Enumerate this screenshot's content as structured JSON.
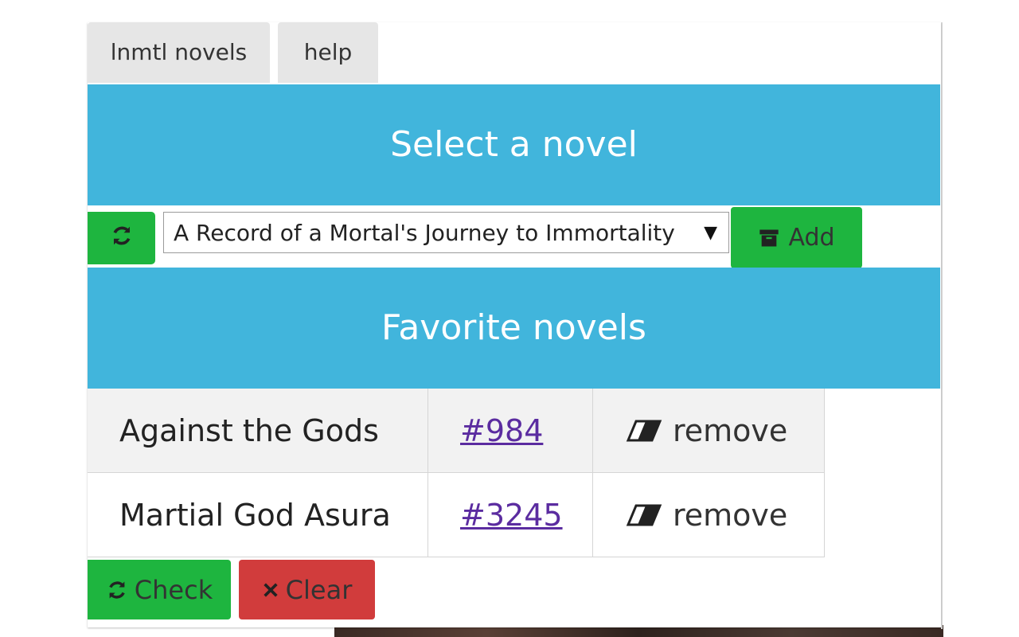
{
  "tabs": [
    {
      "label": "lnmtl novels"
    },
    {
      "label": "help"
    }
  ],
  "select_section": {
    "title": "Select a novel",
    "selected_novel": "A Record of a Mortal's Journey to Immortality",
    "add_label": "Add"
  },
  "favorites": {
    "title": "Favorite novels",
    "rows": [
      {
        "name": "Against the Gods",
        "chapter": "#984",
        "action": "remove"
      },
      {
        "name": "Martial God Asura",
        "chapter": "#3245",
        "action": "remove"
      }
    ]
  },
  "footer": {
    "check_label": "Check",
    "clear_label": "Clear"
  },
  "icons": {
    "refresh": "refresh-icon",
    "archive": "archive-icon",
    "eraser": "eraser-icon",
    "close": "close-icon",
    "dropdown": "caret-down-icon"
  },
  "colors": {
    "header": "#41b5dc",
    "success": "#1eb53f",
    "danger": "#d13c3c",
    "link": "#5b2ca0"
  }
}
